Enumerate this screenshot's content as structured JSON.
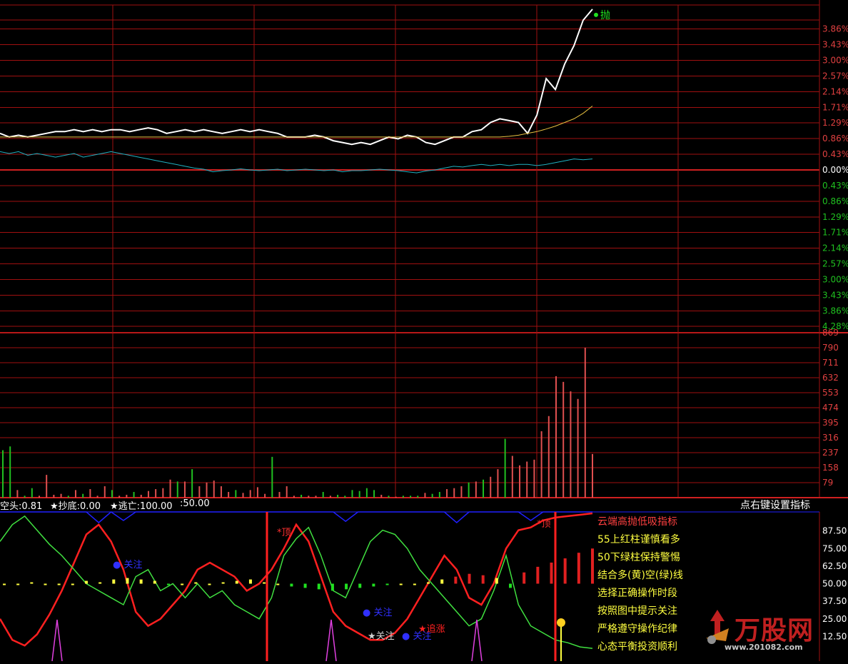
{
  "header": {
    "top_left_fragment": "",
    "top_right_fragment": ""
  },
  "colors": {
    "background": "#000000",
    "grid": "#a01010",
    "price_line": "#ffffff",
    "avg_line": "#e8c040",
    "index_line": "#20b0c0",
    "axis_up": "#e04040",
    "axis_down": "#20c020",
    "volume_up": "#e05050",
    "volume_down": "#20c020"
  },
  "markers": {
    "sell_point": "抛",
    "top_1": "*顶",
    "top_2": "*顶",
    "watch_1": "关注",
    "watch_2": "关注",
    "watch_3": "关注",
    "watch_4": "关注",
    "chase": "追涨"
  },
  "indicator_header": {
    "short_label": "空头:0.81",
    "bottom_label": "抄底:0.00",
    "escape_label": "逃亡:100.00",
    "extra_value": ":50.00",
    "right_hint": "点右键设置指标"
  },
  "legend_lines": [
    "云端高抛低吸指标",
    "55上红柱谨慎看多",
    "50下绿柱保持警惕",
    "结合多(黄)空(绿)线",
    "选择正确操作时段",
    "按照图中提示关注",
    "严格遵守操作纪律",
    "心态平衡投资顺利"
  ],
  "watermark": {
    "brand": "万股网",
    "url": "www.201082.com"
  },
  "chart_data": [
    {
      "type": "line",
      "panel": "intraday price",
      "y_axis_labels_up": [
        "3.86%",
        "3.43%",
        "3.00%",
        "2.57%",
        "2.14%",
        "1.71%",
        "1.29%",
        "0.86%",
        "0.43%",
        "0.00%"
      ],
      "y_axis_labels_down": [
        "0.43%",
        "0.86%",
        "1.29%",
        "1.71%",
        "2.14%",
        "2.57%",
        "3.00%",
        "3.43%",
        "3.86%",
        "4.28%"
      ],
      "ylim": [
        -4.28,
        4.28
      ],
      "series": [
        {
          "role": "price",
          "values": [
            1.0,
            0.9,
            0.95,
            0.9,
            0.95,
            1.0,
            1.05,
            1.05,
            1.1,
            1.05,
            1.1,
            1.05,
            1.1,
            1.1,
            1.05,
            1.1,
            1.15,
            1.1,
            1.0,
            1.05,
            1.1,
            1.05,
            1.1,
            1.05,
            1.0,
            1.05,
            1.1,
            1.05,
            1.1,
            1.05,
            1.0,
            0.9,
            0.9,
            0.9,
            0.95,
            0.9,
            0.8,
            0.75,
            0.7,
            0.75,
            0.7,
            0.8,
            0.9,
            0.85,
            0.95,
            0.9,
            0.75,
            0.7,
            0.8,
            0.9,
            0.9,
            1.05,
            1.1,
            1.3,
            1.4,
            1.35,
            1.3,
            1.0,
            1.5,
            2.5,
            2.2,
            2.9,
            3.4,
            4.1,
            4.4
          ]
        },
        {
          "role": "average",
          "values": [
            0.9,
            0.9,
            0.9,
            0.9,
            0.9,
            0.9,
            0.9,
            0.9,
            0.9,
            0.9,
            0.9,
            0.9,
            0.9,
            0.9,
            0.9,
            0.9,
            0.9,
            0.9,
            0.9,
            0.9,
            0.9,
            0.9,
            0.9,
            0.9,
            0.9,
            0.9,
            0.9,
            0.9,
            0.9,
            0.9,
            0.9,
            0.9,
            0.9,
            0.9,
            0.9,
            0.9,
            0.9,
            0.9,
            0.9,
            0.9,
            0.9,
            0.9,
            0.9,
            0.9,
            0.9,
            0.9,
            0.9,
            0.9,
            0.9,
            0.9,
            0.9,
            0.9,
            0.9,
            0.9,
            0.9,
            0.92,
            0.95,
            1.0,
            1.05,
            1.12,
            1.2,
            1.3,
            1.4,
            1.55,
            1.75
          ]
        },
        {
          "role": "index",
          "values": [
            0.5,
            0.45,
            0.5,
            0.4,
            0.45,
            0.4,
            0.35,
            0.4,
            0.45,
            0.35,
            0.4,
            0.45,
            0.5,
            0.45,
            0.4,
            0.35,
            0.3,
            0.25,
            0.2,
            0.15,
            0.1,
            0.05,
            0.02,
            -0.05,
            -0.02,
            0.0,
            0.03,
            0.0,
            -0.02,
            0.0,
            0.02,
            -0.02,
            0.0,
            0.02,
            0.0,
            -0.02,
            0.0,
            -0.05,
            -0.02,
            -0.02,
            0.0,
            0.02,
            0.0,
            -0.02,
            -0.05,
            -0.08,
            -0.03,
            0.0,
            0.05,
            0.1,
            0.08,
            0.12,
            0.15,
            0.12,
            0.15,
            0.12,
            0.15,
            0.15,
            0.12,
            0.15,
            0.2,
            0.25,
            0.3,
            0.28,
            0.3
          ]
        }
      ]
    },
    {
      "type": "bar",
      "panel": "volume",
      "y_axis_labels": [
        "869",
        "790",
        "711",
        "632",
        "553",
        "474",
        "395",
        "316",
        "237",
        "158",
        "79"
      ],
      "ylim": [
        0,
        869
      ],
      "values": [
        250,
        270,
        40,
        10,
        50,
        10,
        120,
        15,
        20,
        10,
        40,
        20,
        45,
        10,
        60,
        40,
        10,
        15,
        30,
        15,
        35,
        45,
        50,
        95,
        85,
        85,
        150,
        60,
        80,
        90,
        60,
        30,
        40,
        25,
        40,
        55,
        20,
        215,
        30,
        60,
        10,
        15,
        10,
        10,
        30,
        10,
        15,
        10,
        40,
        35,
        50,
        40,
        15,
        10,
        5,
        10,
        10,
        10,
        25,
        20,
        30,
        45,
        50,
        60,
        80,
        85,
        95,
        110,
        150,
        310,
        220,
        170,
        190,
        200,
        350,
        430,
        640,
        610,
        560,
        520,
        790,
        230
      ],
      "down_indices": [
        0,
        1,
        3,
        4,
        9,
        11,
        15,
        18,
        24,
        26,
        32,
        37,
        41,
        44,
        46,
        47,
        48,
        49,
        50,
        51,
        53,
        55,
        56,
        57,
        59,
        60,
        64,
        66,
        69
      ]
    },
    {
      "type": "line",
      "panel": "indicator",
      "y_axis_labels": [
        "87.50",
        "75.00",
        "62.50",
        "50.00",
        "37.50",
        "25.00",
        "12.50"
      ],
      "ylim": [
        0,
        100
      ],
      "series": [
        {
          "role": "red",
          "values": [
            25,
            10,
            6,
            14,
            28,
            45,
            65,
            85,
            92,
            80,
            60,
            30,
            20,
            25,
            35,
            45,
            60,
            65,
            60,
            55,
            45,
            50,
            60,
            75,
            92,
            80,
            55,
            30,
            20,
            15,
            10,
            10,
            15,
            25,
            40,
            55,
            70,
            60,
            40,
            35,
            50,
            75,
            88,
            90,
            95,
            97,
            98,
            99,
            100
          ]
        },
        {
          "role": "green",
          "values": [
            80,
            92,
            98,
            88,
            78,
            70,
            60,
            50,
            45,
            40,
            35,
            55,
            60,
            45,
            50,
            40,
            50,
            40,
            45,
            35,
            30,
            25,
            40,
            70,
            82,
            90,
            70,
            45,
            40,
            60,
            80,
            88,
            85,
            75,
            60,
            50,
            40,
            30,
            20,
            25,
            45,
            70,
            35,
            20,
            15,
            10,
            8,
            5,
            4
          ]
        },
        {
          "role": "blue",
          "values": [
            100,
            100,
            100,
            100,
            100,
            100,
            100,
            100,
            75,
            100,
            80,
            100,
            100,
            100,
            100,
            100,
            100,
            100,
            100,
            100,
            100,
            100,
            100,
            100,
            100,
            100,
            100,
            100,
            78,
            100,
            100,
            100,
            100,
            100,
            100,
            100,
            100,
            75,
            100,
            100,
            100,
            100,
            100,
            80,
            100,
            100,
            100,
            100,
            100
          ]
        },
        {
          "role": "histogram",
          "values": [
            50,
            50,
            51,
            50,
            50,
            50,
            52,
            51,
            53,
            54,
            53,
            52,
            49,
            50,
            51,
            50,
            51,
            52,
            53,
            51,
            50,
            48,
            47,
            46,
            45,
            46,
            47,
            48,
            49,
            50,
            50,
            51,
            53,
            55,
            57,
            56,
            54,
            47,
            58,
            62,
            65,
            68,
            72,
            75
          ]
        }
      ]
    }
  ]
}
